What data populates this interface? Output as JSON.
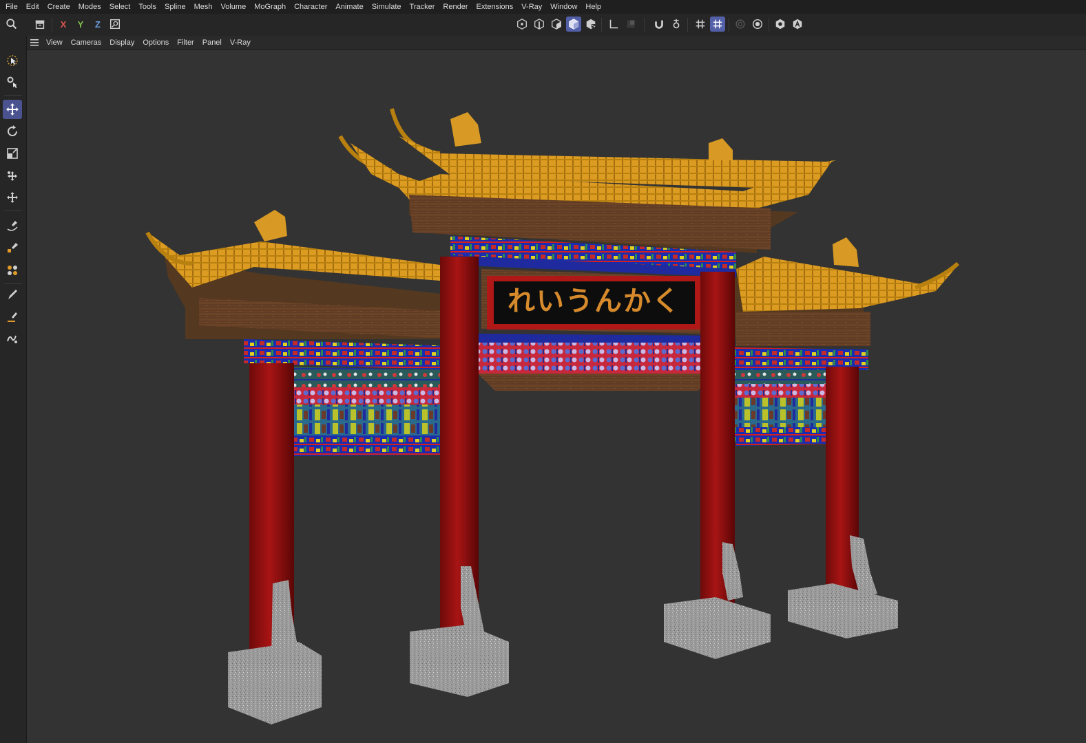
{
  "menubar": {
    "items": [
      "File",
      "Edit",
      "Create",
      "Modes",
      "Select",
      "Tools",
      "Spline",
      "Mesh",
      "Volume",
      "MoGraph",
      "Character",
      "Animate",
      "Simulate",
      "Tracker",
      "Render",
      "Extensions",
      "V-Ray",
      "Window",
      "Help"
    ]
  },
  "toolbar": {
    "axis_x": "X",
    "axis_y": "Y",
    "axis_z": "Z",
    "accent_color": "#5360a8"
  },
  "viewport_menu": {
    "items": [
      "View",
      "Cameras",
      "Display",
      "Options",
      "Filter",
      "Panel",
      "V-Ray"
    ]
  },
  "scene": {
    "sign_text": "れいうんかく",
    "background_color": "#333333"
  }
}
